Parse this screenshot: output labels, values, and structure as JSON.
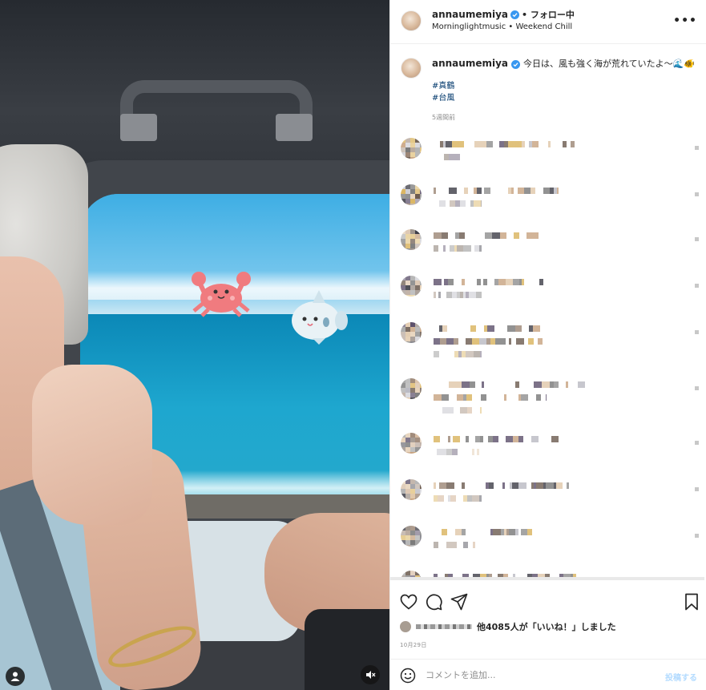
{
  "header": {
    "username": "annaumemiya",
    "follow_status": "• フォロー中",
    "subtitle": "Morninglightmusic • Weekend Chill",
    "more_label": "•••"
  },
  "caption": {
    "username": "annaumemiya",
    "text": "今日は、風も強く海が荒れていたよ〜🌊🐠",
    "hashtags": [
      "#真鶴",
      "#台風"
    ],
    "time": "5週間前"
  },
  "comments_count_visible": 10,
  "likes": {
    "text": "他4085人が「いいね！」しました"
  },
  "post_date": "10月29日",
  "add_comment": {
    "placeholder": "コメントを追加...",
    "post_label": "投稿する"
  },
  "colors": {
    "link": "#00376b",
    "verified": "#3897f0",
    "muted_text": "#8e8e8e",
    "post_button_disabled": "#b3dbff"
  },
  "icons": {
    "like": "heart-icon",
    "comment": "comment-bubble-icon",
    "share": "paper-plane-icon",
    "save": "bookmark-icon",
    "emoji": "smiley-icon",
    "user_tag": "user-icon",
    "mute": "speaker-muted-icon"
  }
}
